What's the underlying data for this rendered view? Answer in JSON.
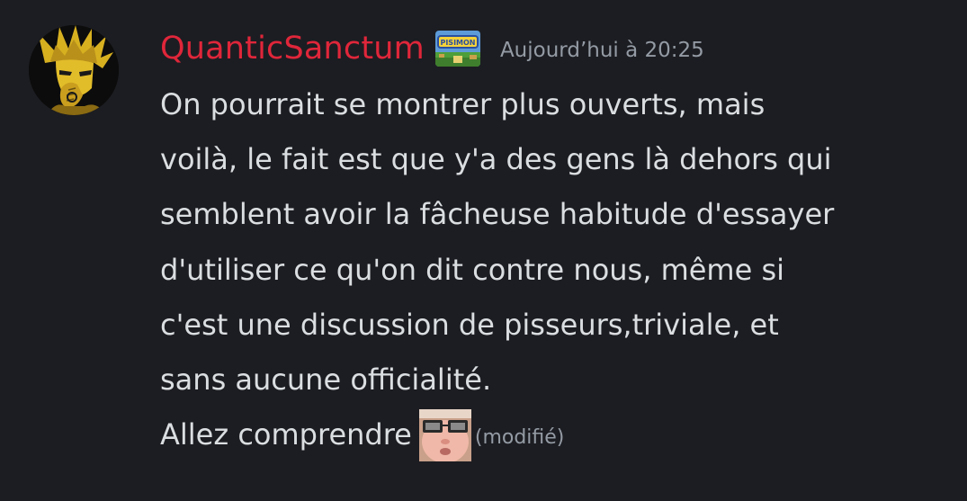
{
  "message": {
    "author": {
      "username": "QuanticSanctum",
      "avatar_icon": "anime-character-avatar",
      "badge_icon": "pixel-game-badge",
      "badge_text": "PISIMON",
      "username_color": "#e0263a"
    },
    "timestamp": "Aujourd’hui à 20:25",
    "content_lines": [
      "On pourrait se montrer plus ouverts, mais",
      "voilà, le fait est que y'a des gens là dehors qui",
      "semblent avoir la fâcheuse habitude d'essayer",
      "d'utiliser ce qu'on dit contre nous, même si",
      "c'est une discussion de pisseurs,triviale, et",
      "sans aucune officialité.",
      "Allez comprendre"
    ],
    "emoji_icon": "face-with-glasses-emoji",
    "edited_label": "(modifié)"
  },
  "colors": {
    "background": "#1c1d22",
    "text": "#dbdee1",
    "muted": "#949ba4"
  }
}
